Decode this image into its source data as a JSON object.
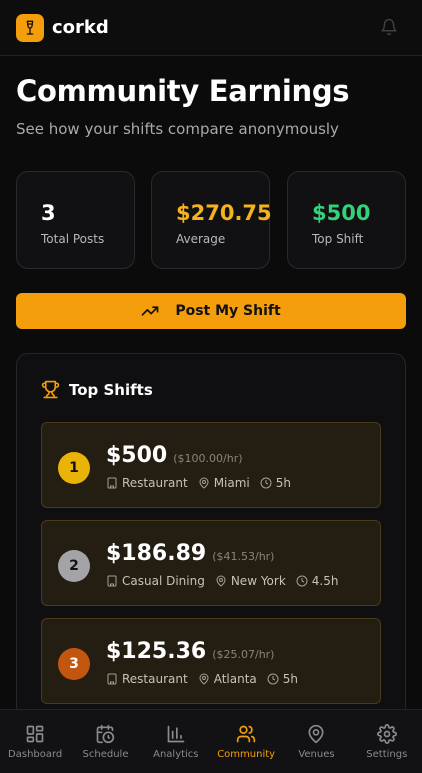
{
  "header": {
    "brand": "corkd",
    "icons": [
      "wine-glass-icon",
      "bell-icon"
    ]
  },
  "page": {
    "title": "Community Earnings",
    "subtitle": "See how your shifts compare anonymously"
  },
  "stats": [
    {
      "value": "3",
      "label": "Total Posts",
      "color": "#ffffff"
    },
    {
      "value": "$270.75",
      "label": "Average",
      "color": "#f6b21c"
    },
    {
      "value": "$500",
      "label": "Top Shift",
      "color": "#33d17a"
    }
  ],
  "post_button": {
    "label": "Post My Shift",
    "icon": "trending-up-icon"
  },
  "top_shifts": {
    "title": "Top Shifts",
    "icon": "trophy-icon",
    "items": [
      {
        "rank": "1",
        "amount": "$500",
        "rate": "($100.00/hr)",
        "venue": "Restaurant",
        "city": "Miami",
        "hours": "5h",
        "rank_color": "#eab308"
      },
      {
        "rank": "2",
        "amount": "$186.89",
        "rate": "($41.53/hr)",
        "venue": "Casual Dining",
        "city": "New York",
        "hours": "4.5h",
        "rank_color": "#a3a3a8"
      },
      {
        "rank": "3",
        "amount": "$125.36",
        "rate": "($25.07/hr)",
        "venue": "Restaurant",
        "city": "Atlanta",
        "hours": "5h",
        "rank_color": "#c2560f"
      }
    ]
  },
  "nav": {
    "items": [
      {
        "label": "Dashboard",
        "icon": "grid-icon"
      },
      {
        "label": "Schedule",
        "icon": "calendar-clock-icon"
      },
      {
        "label": "Analytics",
        "icon": "bar-chart-icon"
      },
      {
        "label": "Community",
        "icon": "users-icon",
        "active": true
      },
      {
        "label": "Venues",
        "icon": "map-pin-icon"
      },
      {
        "label": "Settings",
        "icon": "gear-icon"
      }
    ]
  },
  "colors": {
    "accent": "#f59e0b",
    "background": "#0b0b0c",
    "success": "#33d17a"
  }
}
